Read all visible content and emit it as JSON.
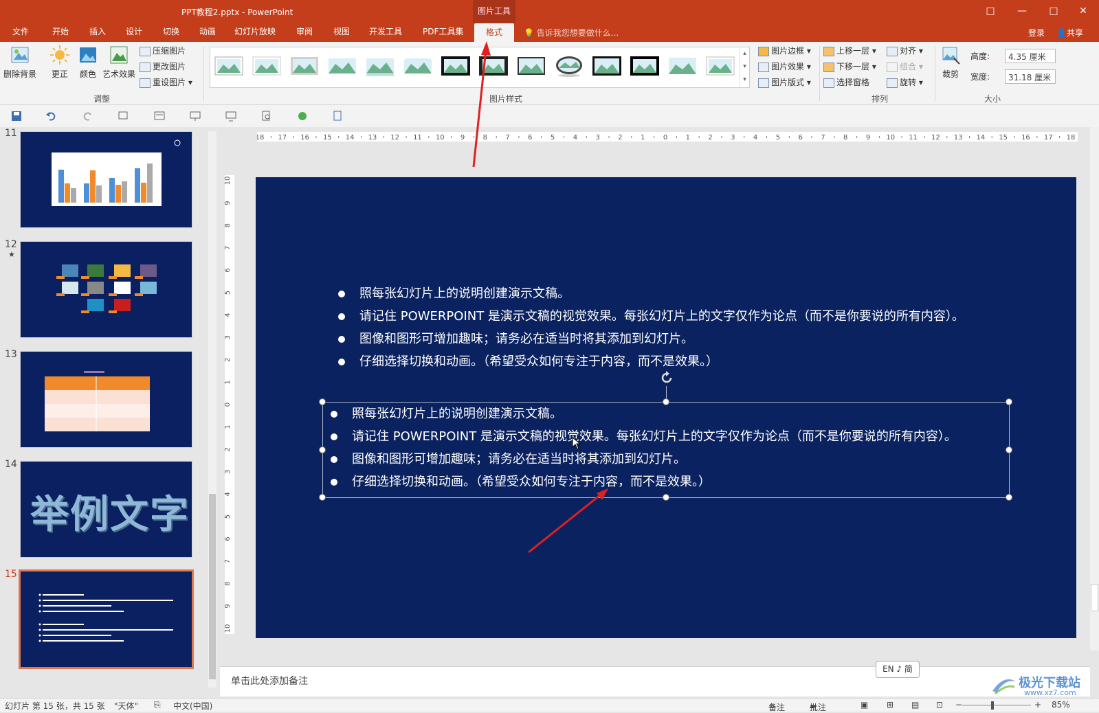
{
  "title_bar": {
    "title": "PPT教程2.pptx - PowerPoint",
    "context_label": "图片工具",
    "buttons": [
      "□",
      "—",
      "□",
      "✕"
    ]
  },
  "tabs": [
    "文件",
    "开始",
    "插入",
    "设计",
    "切换",
    "动画",
    "幻灯片放映",
    "审阅",
    "视图",
    "开发工具",
    "PDF工具集",
    "格式"
  ],
  "active_tab": "格式",
  "tell_me": "告诉我您想要做什么...",
  "login": "登录",
  "share": "共享",
  "ribbon": {
    "adjust": {
      "remove_bg": "删除背景",
      "corrections": "更正",
      "color": "颜色",
      "artistic": "艺术效果",
      "compress": "压缩图片",
      "change": "更改图片",
      "reset": "重设图片",
      "label": "调整"
    },
    "styles_label": "图片样式",
    "picture_border": "图片边框",
    "picture_effects": "图片效果",
    "picture_layout": "图片版式",
    "arrange": {
      "bring_forward": "上移一层",
      "send_backward": "下移一层",
      "selection_pane": "选择窗格",
      "align": "对齐",
      "group": "组合",
      "rotate": "旋转",
      "label": "排列"
    },
    "size": {
      "crop": "裁剪",
      "height_label": "高度:",
      "height_value": "4.35 厘米",
      "width_label": "宽度:",
      "width_value": "31.18 厘米",
      "label": "大小"
    }
  },
  "slide_numbers": [
    "11",
    "12",
    "13",
    "14",
    "15"
  ],
  "slide14_text": "举例文字",
  "horizontal_ruler": [
    "18",
    "17",
    "16",
    "15",
    "14",
    "13",
    "12",
    "11",
    "10",
    "9",
    "8",
    "7",
    "6",
    "5",
    "4",
    "3",
    "2",
    "1",
    "0",
    "1",
    "2",
    "3",
    "4",
    "5",
    "6",
    "7",
    "8",
    "9",
    "10",
    "11",
    "12",
    "13",
    "14",
    "15",
    "16",
    "17",
    "18"
  ],
  "vertical_ruler": [
    "10",
    "9",
    "8",
    "7",
    "6",
    "5",
    "4",
    "3",
    "2",
    "1",
    "0",
    "1",
    "2",
    "3",
    "4",
    "5",
    "6",
    "7",
    "8",
    "9",
    "10"
  ],
  "bullets_top": [
    "照每张幻灯片上的说明创建演示文稿。",
    "请记住 POWERPOINT 是演示文稿的视觉效果。每张幻灯片上的文字仅作为论点（而不是你要说的所有内容）。",
    "图像和图形可增加趣味；请务必在适当时将其添加到幻灯片。",
    "仔细选择切换和动画。（希望受众如何专注于内容，而不是效果。）"
  ],
  "bullets_selected": [
    "照每张幻灯片上的说明创建演示文稿。",
    "请记住 POWERPOINT 是演示文稿的视觉效果。每张幻灯片上的文字仅作为论点（而不是你要说的所有内容）。",
    "图像和图形可增加趣味；请务必在适当时将其添加到幻灯片。",
    "仔细选择切换和动画。（希望受众如何专注于内容，而不是效果。）"
  ],
  "notes_placeholder": "单击此处添加备注",
  "ime": "EN ♪ 简",
  "status": {
    "slide_info": "幻灯片 第 15 张，共 15 张",
    "theme": "\"天体\"",
    "language": "中文(中国)",
    "notes": "备注",
    "comments": "批注",
    "zoom": "85%"
  },
  "watermark": {
    "line1": "极光下载站",
    "line2": "www.xz7.com"
  },
  "colors": {
    "ribbon_red": "#c43e1c",
    "slide_bg": "#0a2260",
    "arrow": "#e02020"
  }
}
